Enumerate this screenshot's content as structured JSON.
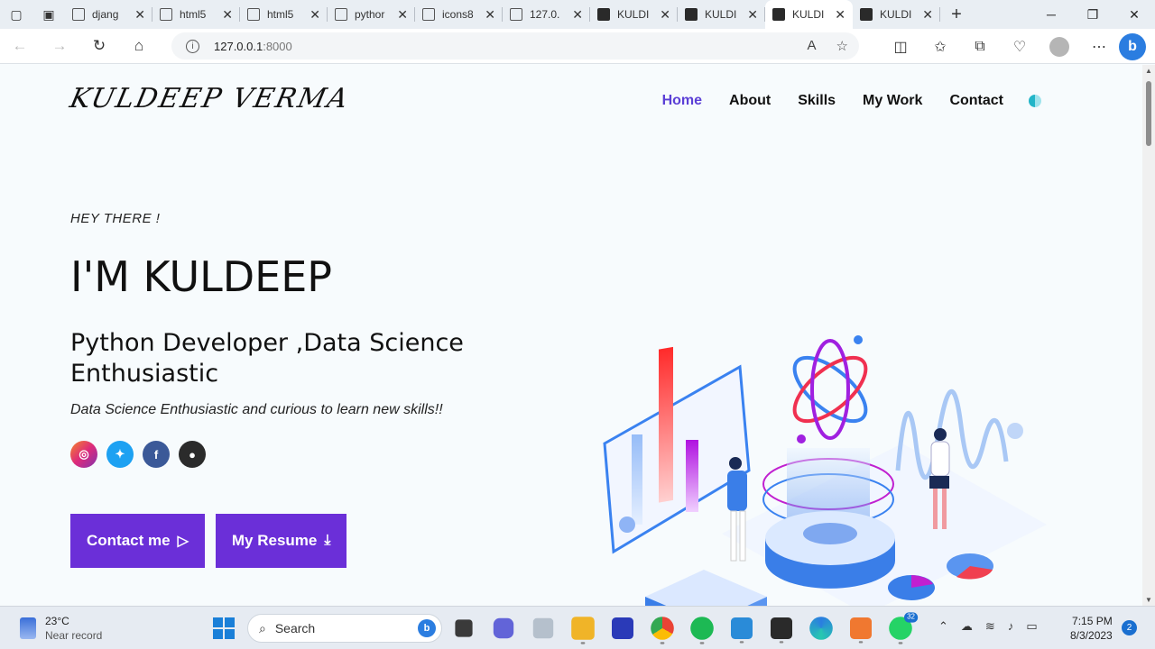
{
  "browser": {
    "tabs": [
      {
        "label": "djang",
        "fav": "doc"
      },
      {
        "label": "html5",
        "fav": "doc"
      },
      {
        "label": "html5",
        "fav": "doc"
      },
      {
        "label": "pythor",
        "fav": "doc"
      },
      {
        "label": "icons8",
        "fav": "doc"
      },
      {
        "label": "127.0.",
        "fav": "doc"
      },
      {
        "label": "KULDI",
        "fav": "dark"
      },
      {
        "label": "KULDI",
        "fav": "dark"
      },
      {
        "label": "KULDI",
        "fav": "dark",
        "active": true
      },
      {
        "label": "KULDI",
        "fav": "dark"
      }
    ],
    "url_host": "127.0.0.1",
    "url_port": ":8000"
  },
  "site": {
    "logo": "KULDEEP VERMA",
    "nav": [
      "Home",
      "About",
      "Skills",
      "My Work",
      "Contact"
    ],
    "nav_active": "Home",
    "greeting": "HEY THERE !",
    "headline": "I'M KULDEEP",
    "role": "Python Developer ,Data Science Enthusiastic",
    "tagline": "Data Science Enthusiastic and curious to learn new skills!!",
    "buttons": {
      "contact": "Contact me",
      "resume": "My Resume"
    },
    "accent_color": "#6b2fd8"
  },
  "taskbar": {
    "weather_temp": "23°C",
    "weather_desc": "Near record",
    "search_placeholder": "Search",
    "whatsapp_badge": "32",
    "time": "7:15 PM",
    "date": "8/3/2023",
    "notifications": "2"
  }
}
